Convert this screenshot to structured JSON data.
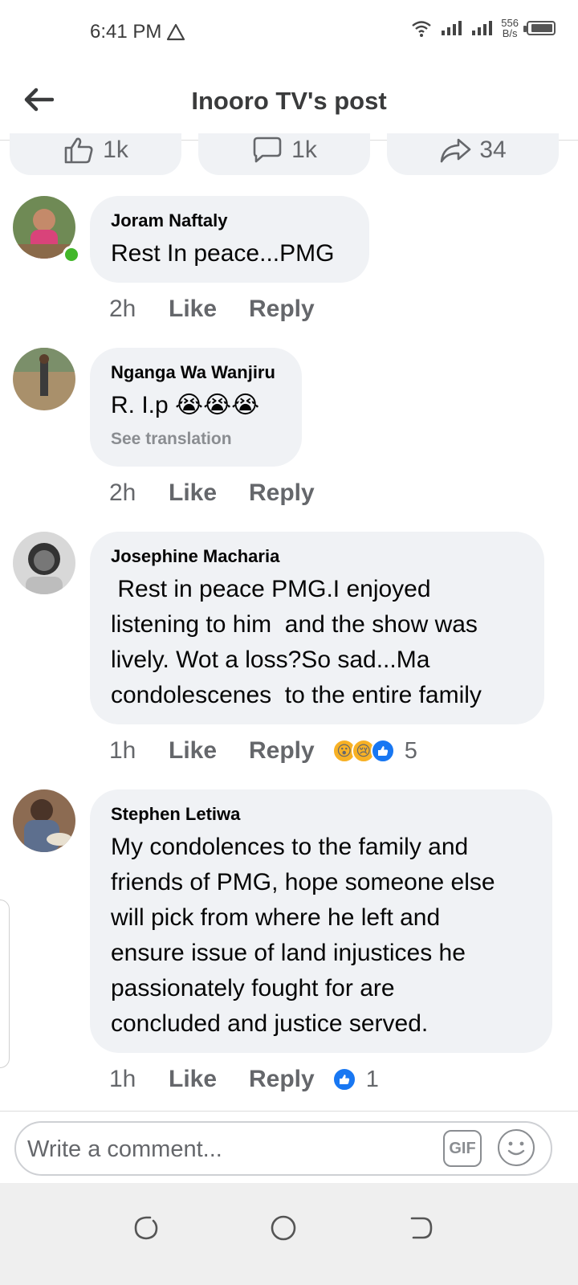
{
  "status_bar": {
    "time": "6:41 PM",
    "net_speed_value": "556",
    "net_speed_unit": "B/s"
  },
  "header": {
    "title": "Inooro TV's post",
    "back_icon": "arrow-left-icon"
  },
  "post_stats": {
    "likes": "1k",
    "comments": "1k",
    "shares": "34"
  },
  "comments": [
    {
      "name": "Joram Naftaly",
      "text": "Rest In peace...PMG",
      "time": "2h",
      "like_label": "Like",
      "reply_label": "Reply",
      "online": true
    },
    {
      "name": "Nganga Wa Wanjiru",
      "text": "R. I.p 😭😭😭",
      "see_translation": "See translation",
      "time": "2h",
      "like_label": "Like",
      "reply_label": "Reply"
    },
    {
      "name": "Josephine Macharia",
      "text": " Rest in peace PMG.I enjoyed\nlistening to him  and the show was\nlively. Wot a loss?So sad...Ma\ncondolescenes  to the entire family",
      "time": "1h",
      "like_label": "Like",
      "reply_label": "Reply",
      "reactions": [
        "wow",
        "sad",
        "like"
      ],
      "reaction_count": "5"
    },
    {
      "name": "Stephen Letiwa",
      "text": "My condolences to the family and\nfriends of PMG, hope someone else\nwill pick from where he left and\nensure issue of land injustices he\npassionately fought for are\nconcluded and justice served.",
      "time": "1h",
      "like_label": "Like",
      "reply_label": "Reply",
      "reactions": [
        "like"
      ],
      "reaction_count": "1"
    }
  ],
  "composer": {
    "placeholder": "Write a comment...",
    "gif_label": "GIF"
  },
  "colors": {
    "bubble_bg": "#f0f2f5",
    "secondary_text": "#65676b",
    "online": "#42b72a",
    "like_blue": "#1877f2"
  }
}
